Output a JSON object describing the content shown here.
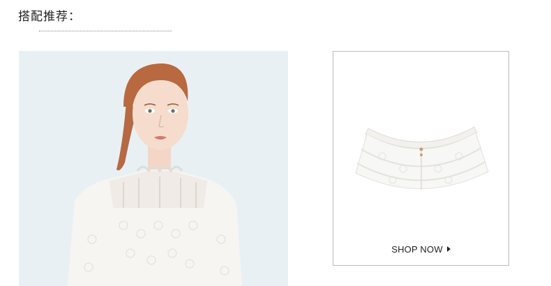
{
  "section": {
    "title": "搭配推荐："
  },
  "product": {
    "cta_label": "SHOP NOW",
    "cta_icon": "play-triangle-icon",
    "name_semantic": "white-lace-ruffle-cape"
  },
  "model": {
    "semantic": "model-wearing-white-lace-blouse"
  },
  "colors": {
    "model_background": "#e9f0f4",
    "card_border": "#bcbcbc",
    "text": "#222222"
  }
}
